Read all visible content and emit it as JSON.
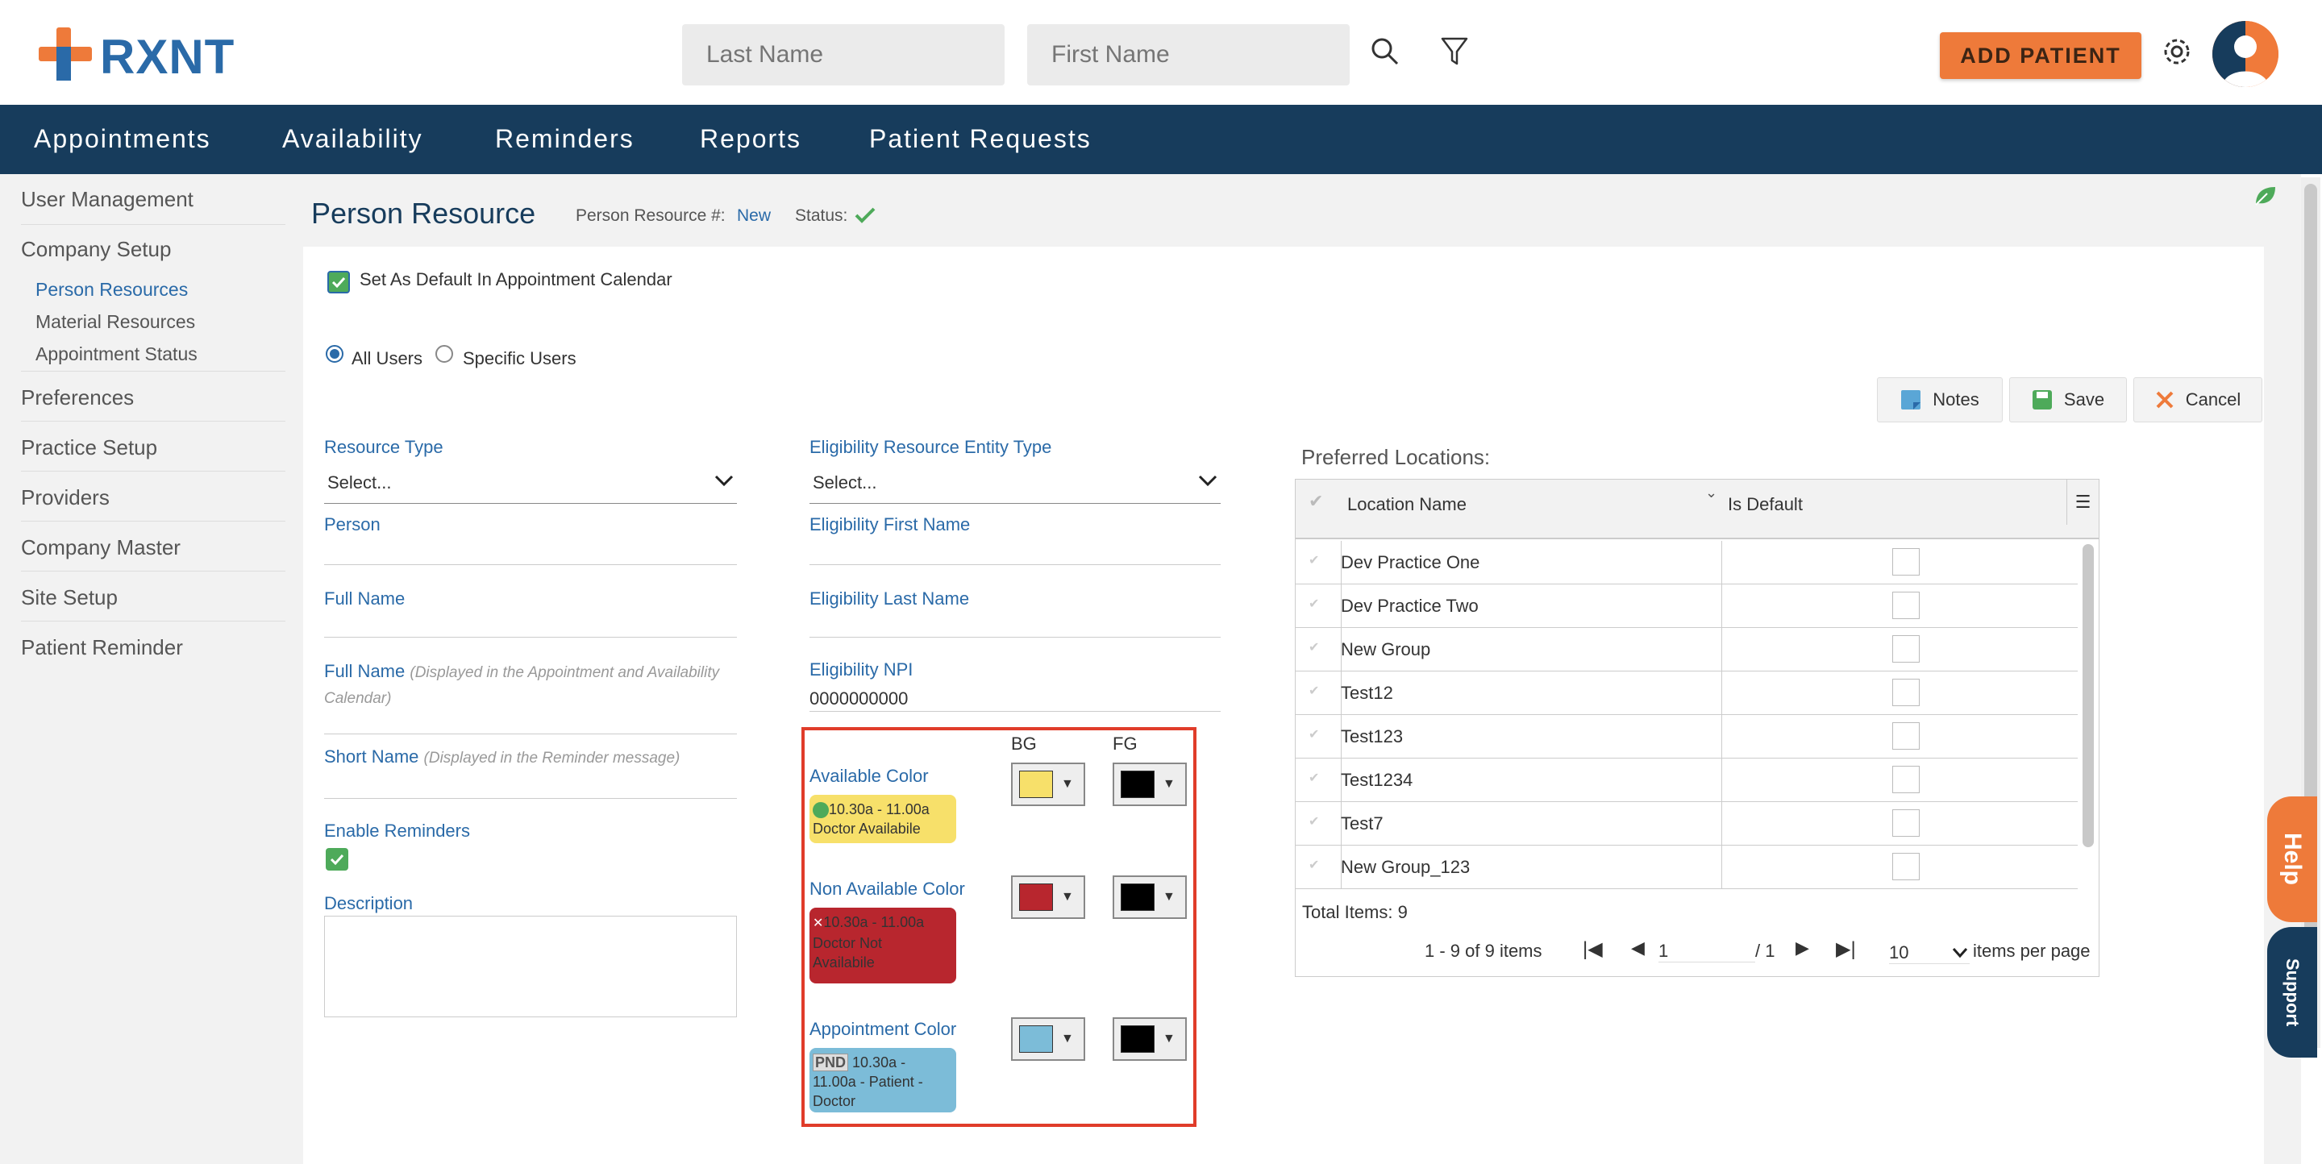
{
  "brand": {
    "name": "RXNT",
    "orange": "#ee7a3a",
    "blue": "#2a6aa8",
    "navy": "#173c5c"
  },
  "header": {
    "last_name_placeholder": "Last Name",
    "first_name_placeholder": "First Name",
    "add_patient": "ADD PATIENT"
  },
  "nav": [
    "Appointments",
    "Availability",
    "Reminders",
    "Reports",
    "Patient Requests"
  ],
  "sidebar": {
    "items": [
      "User Management",
      "Company Setup",
      "Preferences",
      "Practice Setup",
      "Providers",
      "Company Master",
      "Site Setup",
      "Patient Reminder"
    ],
    "sub_items": [
      "Person Resources",
      "Material Resources",
      "Appointment Status"
    ]
  },
  "page": {
    "title": "Person Resource",
    "resource_num_label": "Person Resource #:",
    "resource_num_value": "New",
    "status_label": "Status:"
  },
  "form": {
    "default_label": "Set As Default In Appointment Calendar",
    "all_users": "All Users",
    "specific_users": "Specific Users",
    "resource_type_label": "Resource Type",
    "resource_type_value": "Select...",
    "person_label": "Person",
    "full_name_label": "Full Name",
    "full_name2_label": "Full Name",
    "full_name2_hint_a": "(Displayed in the Appointment and Availability",
    "full_name2_hint_b": "Calendar)",
    "short_name_label": "Short Name",
    "short_name_hint": "(Displayed in the Reminder message)",
    "enable_reminders_label": "Enable Reminders",
    "description_label": "Description",
    "elig_entity_label": "Eligibility Resource Entity Type",
    "elig_entity_value": "Select...",
    "elig_first_label": "Eligibility First Name",
    "elig_last_label": "Eligibility Last Name",
    "elig_npi_label": "Eligibility NPI",
    "elig_npi_value": "0000000000"
  },
  "colors": {
    "bg_header": "BG",
    "fg_header": "FG",
    "available_label": "Available Color",
    "available_sample_a": "10.30a - 11.00a",
    "available_sample_b": "Doctor Availabile",
    "available_bg": "#f7e06a",
    "non_available_label": "Non Available Color",
    "non_available_sample_a": "10.30a - 11.00a",
    "non_available_sample_b": "Doctor Not",
    "non_available_sample_c": "Availabile",
    "non_available_bg": "#b8262e",
    "appointment_label": "Appointment Color",
    "appointment_badge": "PND",
    "appointment_sample_a": "10.30a -",
    "appointment_sample_b": "11.00a - Patient -",
    "appointment_sample_c": "Doctor",
    "appointment_bg": "#7cbcd8",
    "fg_color": "#000000"
  },
  "buttons": {
    "notes": "Notes",
    "save": "Save",
    "cancel": "Cancel"
  },
  "locations": {
    "title": "Preferred Locations:",
    "columns": [
      "Location Name",
      "Is Default"
    ],
    "rows": [
      "Dev Practice One",
      "Dev Practice Two",
      "New Group",
      "Test12",
      "Test123",
      "Test1234",
      "Test7",
      "New Group_123"
    ],
    "total": "Total Items: 9",
    "range": "1 - 9 of 9 items",
    "page": "1",
    "of_pages": "/ 1",
    "page_size": "10",
    "per_page": "items per page"
  },
  "side_tabs": {
    "help": "Help",
    "support": "Support"
  }
}
